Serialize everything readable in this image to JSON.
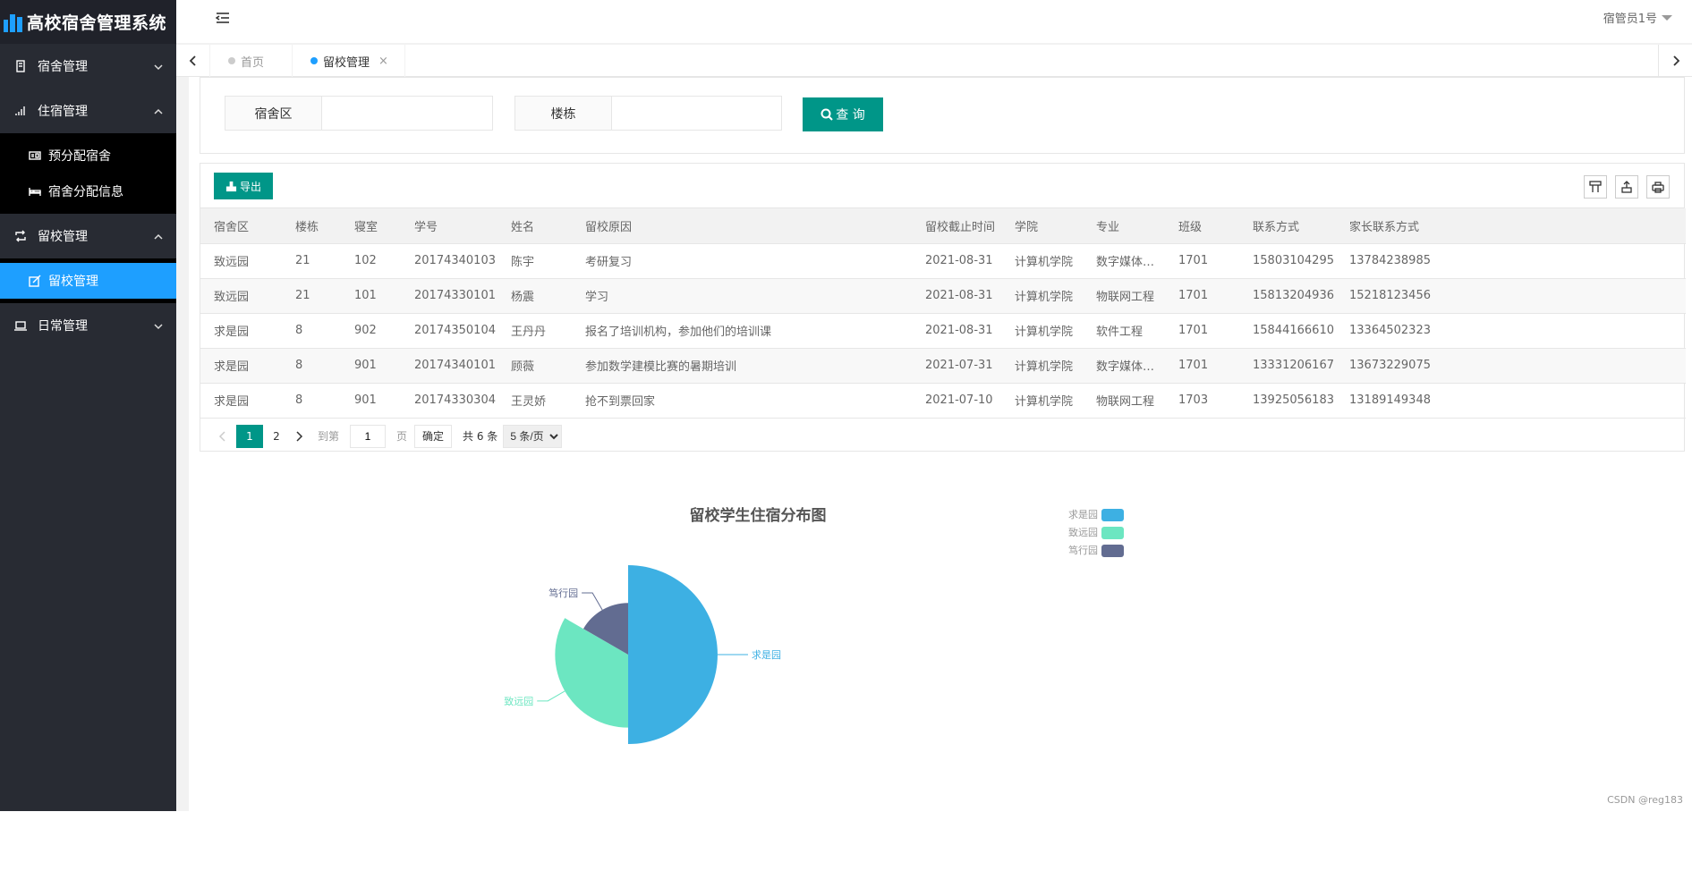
{
  "app": {
    "title": "高校宿舍管理系统"
  },
  "sidebar": {
    "groups": [
      {
        "label": "宿舍管理",
        "icon": "building-icon",
        "expanded": false
      },
      {
        "label": "住宿管理",
        "icon": "signal-icon",
        "expanded": true,
        "items": [
          {
            "label": "预分配宿舍",
            "icon": "id-card-icon"
          },
          {
            "label": "宿舍分配信息",
            "icon": "bed-icon"
          }
        ]
      },
      {
        "label": "留校管理",
        "icon": "retweet-icon",
        "expanded": true,
        "items": [
          {
            "label": "留校管理",
            "icon": "edit-icon",
            "active": true
          }
        ]
      },
      {
        "label": "日常管理",
        "icon": "laptop-icon",
        "expanded": false
      }
    ]
  },
  "header": {
    "user": "宿管员1号"
  },
  "tabs": [
    {
      "label": "首页",
      "active": false
    },
    {
      "label": "留校管理",
      "active": true,
      "close": "×"
    }
  ],
  "search": {
    "area_label": "宿舍区",
    "area_value": "",
    "building_label": "楼栋",
    "building_value": "",
    "query_label": "查 询"
  },
  "toolbar": {
    "export_label": "导出"
  },
  "table": {
    "columns": [
      "宿舍区",
      "楼栋",
      "寝室",
      "学号",
      "姓名",
      "留校原因",
      "留校截止时间",
      "学院",
      "专业",
      "班级",
      "联系方式",
      "家长联系方式"
    ],
    "rows": [
      [
        "致远园",
        "21",
        "102",
        "20174340103",
        "陈宇",
        "考研复习",
        "2021-08-31",
        "计算机学院",
        "数字媒体技术",
        "1701",
        "15803104295",
        "13784238985"
      ],
      [
        "致远园",
        "21",
        "101",
        "20174330101",
        "杨震",
        "学习",
        "2021-08-31",
        "计算机学院",
        "物联网工程",
        "1701",
        "15813204936",
        "15218123456"
      ],
      [
        "求是园",
        "8",
        "902",
        "20174350104",
        "王丹丹",
        "报名了培训机构，参加他们的培训课",
        "2021-08-31",
        "计算机学院",
        "软件工程",
        "1701",
        "15844166610",
        "13364502323"
      ],
      [
        "求是园",
        "8",
        "901",
        "20174340101",
        "顾薇",
        "参加数学建模比赛的暑期培训",
        "2021-07-31",
        "计算机学院",
        "数字媒体技术",
        "1701",
        "13331206167",
        "13673229075"
      ],
      [
        "求是园",
        "8",
        "901",
        "20174330304",
        "王灵娇",
        "抢不到票回家",
        "2021-07-10",
        "计算机学院",
        "物联网工程",
        "1703",
        "13925056183",
        "13189149348"
      ]
    ]
  },
  "pager": {
    "pages": [
      "1",
      "2"
    ],
    "current": "1",
    "goto_label": "到第",
    "goto_value": "1",
    "page_unit": "页",
    "confirm_label": "确定",
    "total_label": "共 6 条",
    "size_label": "5 条/页"
  },
  "chart_data": {
    "type": "pie",
    "variant": "rose",
    "title": "留校学生住宿分布图",
    "categories": [
      "求是园",
      "致远园",
      "笃行园"
    ],
    "values": [
      3,
      2,
      1
    ],
    "colors": [
      "#3db0e3",
      "#6ce6c1",
      "#626c91"
    ],
    "legend_position": "top-right"
  },
  "watermark": "CSDN @reg183"
}
